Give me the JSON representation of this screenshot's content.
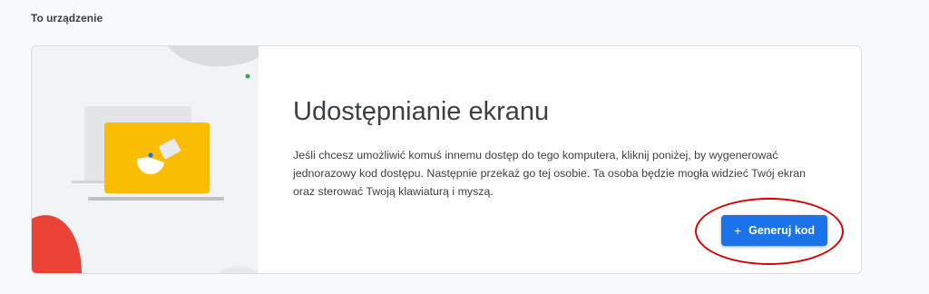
{
  "section": {
    "title": "To urządzenie"
  },
  "card": {
    "heading": "Udostępnianie ekranu",
    "description": "Jeśli chcesz umożliwić komuś innemu dostęp do tego komputera, kliknij poniżej, by wygenerować jednorazowy kod dostępu. Następnie przekaż go tej osobie. Ta osoba będzie mogła widzieć Twój ekran oraz sterować Twoją klawiaturą i myszą.",
    "button": {
      "label": "Generuj kod",
      "icon": "plus-icon"
    }
  },
  "colors": {
    "accent": "#1a73e8",
    "laptop": "#fbbc04",
    "blob_red": "#ea4335",
    "dot_green": "#34a853",
    "annotation": "#d50000"
  }
}
